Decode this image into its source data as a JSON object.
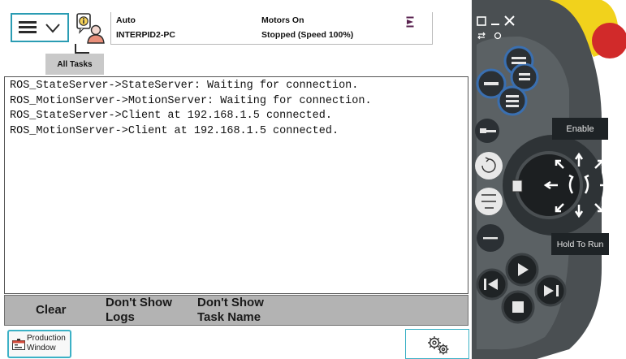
{
  "menu": {
    "icon": "hamburger-icon",
    "dropdown_icon": "chevron-down-icon"
  },
  "tasks_tab": {
    "label": "All Tasks",
    "icon": "task-info-icon"
  },
  "status": {
    "mode": "Auto",
    "controller": "INTERPID2-PC",
    "motors": "Motors On",
    "program_state": "Stopped (Speed 100%)",
    "indicator_icon": "program-status-icon"
  },
  "log": {
    "lines": [
      "ROS_StateServer->StateServer: Waiting for connection.",
      "ROS_MotionServer->MotionServer: Waiting for connection.",
      "ROS_StateServer->Client at 192.168.1.5 connected.",
      "ROS_MotionServer->Client at 192.168.1.5 connected."
    ]
  },
  "toolbar": {
    "clear_label": "Clear",
    "dont_show_logs_line1": "Don't Show",
    "dont_show_logs_line2": "Logs",
    "dont_show_task_name_line1": "Don't Show",
    "dont_show_task_name_line2": "Task Name"
  },
  "bottom": {
    "production_window_line1": "Production",
    "production_window_line2": "Window",
    "quickset_icon": "gears-icon"
  },
  "pendant": {
    "enable_label": "Enable",
    "hold_to_run_label": "Hold To Run",
    "colors": {
      "body": "#4a4f52",
      "key_blue": "#3a6fb0",
      "key_dark": "#2b3034",
      "enabling_yellow": "#f1d21c",
      "emergency_red": "#d12a2a",
      "teal_accent": "#2a9cb3"
    }
  }
}
